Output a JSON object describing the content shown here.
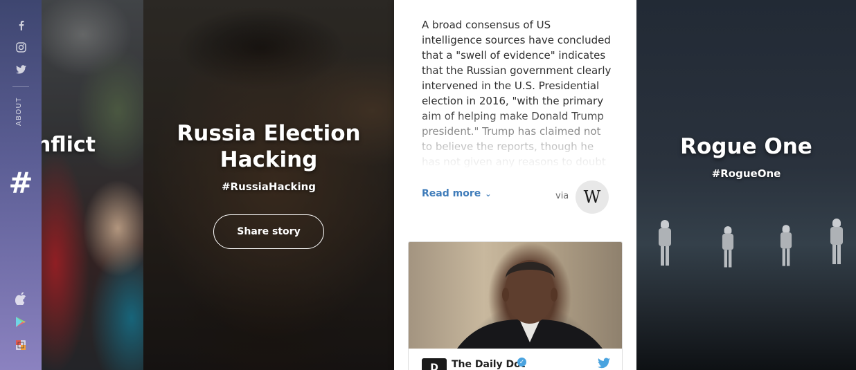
{
  "sidebar": {
    "social": [
      {
        "name": "facebook-icon",
        "glyph": "f"
      },
      {
        "name": "instagram-icon",
        "glyph": ""
      },
      {
        "name": "twitter-icon",
        "glyph": ""
      }
    ],
    "about_label": "ABOUT",
    "logo_glyph": "#",
    "stores": [
      {
        "name": "apple-icon"
      },
      {
        "name": "google-play-icon"
      },
      {
        "name": "amazon-icon"
      }
    ]
  },
  "stories": {
    "conflict": {
      "title_fragment": "nflict"
    },
    "russia": {
      "title_line1": "Russia Election",
      "title_line2": "Hacking",
      "hashtag": "#RussiaHacking",
      "share_label": "Share story"
    },
    "article": {
      "body": "A broad consensus of US intelligence sources have concluded that a \"swell of evidence\" indicates that the Russian government clearly intervened in the U.S. Presidential election in 2016, \"with the primary aim of helping make Donald Trump president.\" Trump has claimed not to believe the reports, though he has not given any reasons to doubt the",
      "read_more_label": "Read more",
      "read_more_chevron": "⌄",
      "via_label": "via",
      "source_glyph": "W",
      "source_name": "wikipedia-icon",
      "tweet": {
        "logo_glyph": "D",
        "account_name": "The Daily Dot",
        "verified_glyph": "✓"
      }
    },
    "rogue": {
      "title": "Rogue One",
      "hashtag": "#RogueOne"
    }
  },
  "colors": {
    "sidebar_top": "#3e4670",
    "sidebar_bottom": "#8b82c0",
    "link_blue": "#3f7cba",
    "twitter_blue": "#4aa3df"
  }
}
